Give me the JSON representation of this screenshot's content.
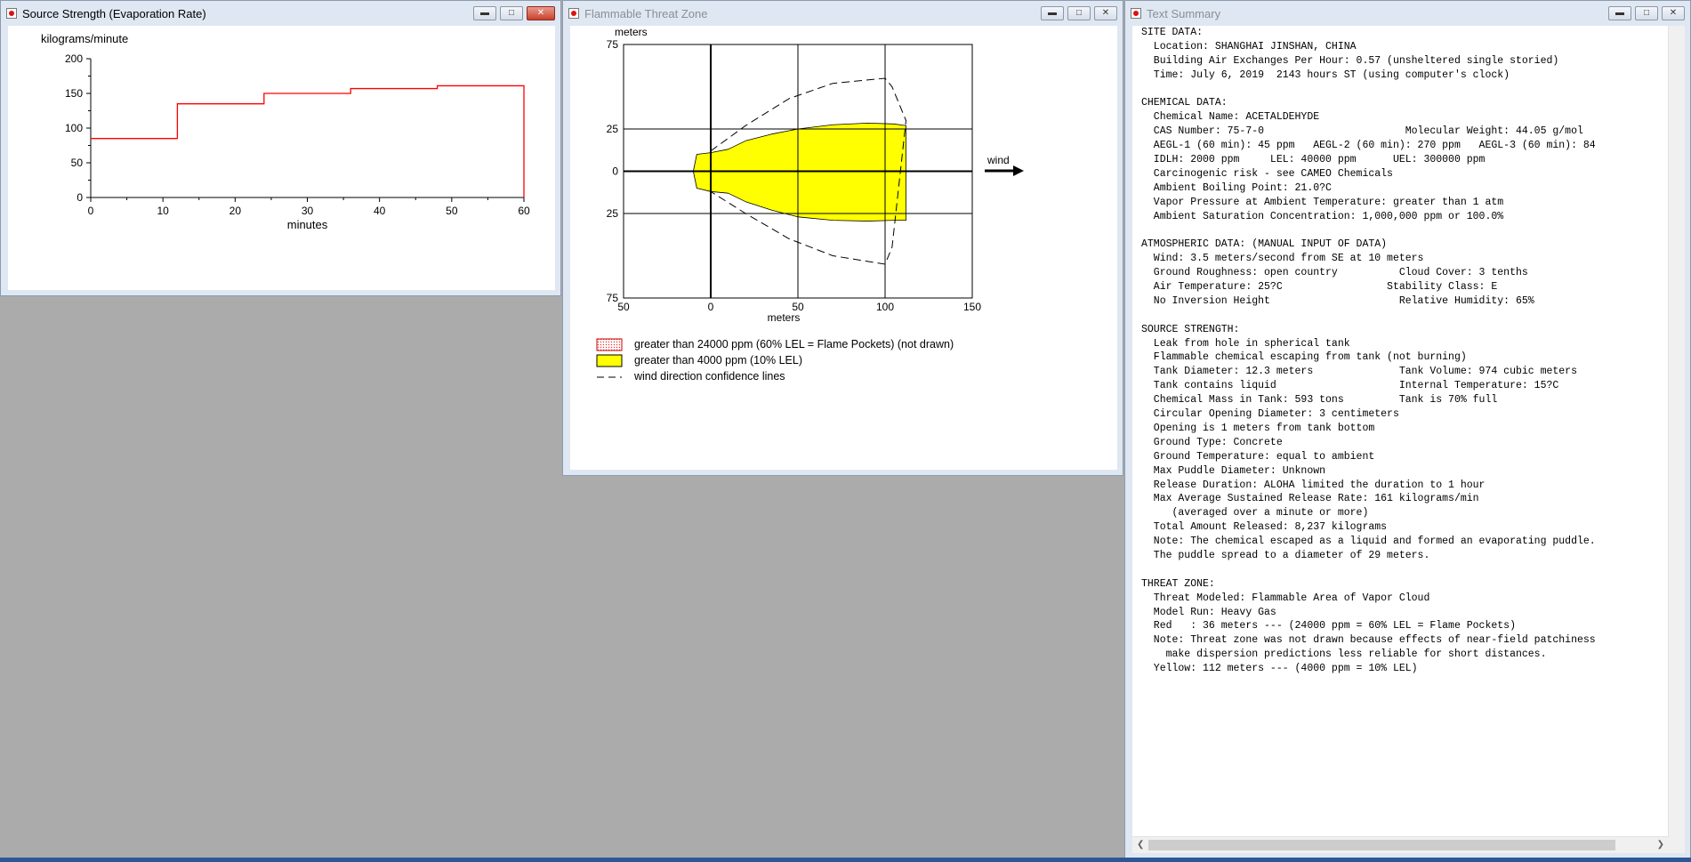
{
  "windows": {
    "source": {
      "title": "Source Strength (Evaporation Rate)"
    },
    "threat": {
      "title": "Flammable Threat Zone"
    },
    "summary": {
      "title": "Text Summary"
    }
  },
  "chart_data": [
    {
      "type": "line",
      "ylabel": "kilograms/minute",
      "xlabel": "minutes",
      "xlim": [
        0,
        60
      ],
      "ylim": [
        0,
        200
      ],
      "x_ticks": [
        "0",
        "10",
        "20",
        "30",
        "40",
        "50",
        "60"
      ],
      "y_ticks": [
        "0",
        "50",
        "100",
        "150",
        "200"
      ],
      "series": [
        {
          "color": "#ff0000",
          "step": true,
          "x": [
            0,
            12,
            12,
            24,
            24,
            36,
            36,
            48,
            48,
            60,
            60
          ],
          "y": [
            85,
            85,
            135,
            135,
            150,
            150,
            157,
            157,
            161,
            161,
            0
          ]
        }
      ]
    },
    {
      "type": "area",
      "ylabel": "meters",
      "xlabel": "meters",
      "xlim": [
        -50,
        150
      ],
      "ylim": [
        -75,
        75
      ],
      "x_ticks": [
        "50",
        "0",
        "50",
        "100",
        "150"
      ],
      "y_ticks": [
        "75",
        "25",
        "0",
        "25",
        "75"
      ],
      "wind_label": "wind",
      "legend": [
        {
          "label": "greater than 24000 ppm (60% LEL = Flame Pockets) (not drawn)",
          "swatch": "dotted-red"
        },
        {
          "label": "greater than 4000 ppm (10% LEL)",
          "swatch": "#ffff00"
        },
        {
          "label": "wind direction confidence lines",
          "swatch": "dashed"
        }
      ],
      "yellow_zone": {
        "color": "#ffff00",
        "x": [
          -10,
          -8,
          0,
          10,
          20,
          35,
          50,
          70,
          90,
          105,
          112,
          112,
          105,
          90,
          70,
          50,
          35,
          20,
          10,
          0,
          -8
        ],
        "y": [
          0,
          10,
          11,
          13,
          18,
          22,
          25,
          27.5,
          28.5,
          28,
          27,
          -29,
          -29,
          -29.5,
          -29,
          -27,
          -23,
          -18,
          -13,
          -12,
          -10
        ]
      },
      "confidence_lines": {
        "x": [
          0,
          20,
          45,
          70,
          100,
          104,
          112,
          104,
          100,
          70,
          45,
          20,
          0
        ],
        "y": [
          12,
          27,
          43,
          52,
          55,
          50,
          30,
          -45,
          -55,
          -50,
          -40,
          -25,
          -12
        ]
      }
    }
  ],
  "summary_lines": [
    "SITE DATA:",
    "  Location: SHANGHAI JINSHAN, CHINA",
    "  Building Air Exchanges Per Hour: 0.57 (unsheltered single storied)",
    "  Time: July 6, 2019  2143 hours ST (using computer's clock)",
    "",
    "CHEMICAL DATA:",
    "  Chemical Name: ACETALDEHYDE",
    "  CAS Number: 75-7-0                       Molecular Weight: 44.05 g/mol",
    "  AEGL-1 (60 min): 45 ppm   AEGL-2 (60 min): 270 ppm   AEGL-3 (60 min): 84",
    "  IDLH: 2000 ppm     LEL: 40000 ppm      UEL: 300000 ppm",
    "  Carcinogenic risk - see CAMEO Chemicals",
    "  Ambient Boiling Point: 21.0?C",
    "  Vapor Pressure at Ambient Temperature: greater than 1 atm",
    "  Ambient Saturation Concentration: 1,000,000 ppm or 100.0%",
    "",
    "ATMOSPHERIC DATA: (MANUAL INPUT OF DATA)",
    "  Wind: 3.5 meters/second from SE at 10 meters",
    "  Ground Roughness: open country          Cloud Cover: 3 tenths",
    "  Air Temperature: 25?C                 Stability Class: E",
    "  No Inversion Height                     Relative Humidity: 65%",
    "",
    "SOURCE STRENGTH:",
    "  Leak from hole in spherical tank",
    "  Flammable chemical escaping from tank (not burning)",
    "  Tank Diameter: 12.3 meters              Tank Volume: 974 cubic meters",
    "  Tank contains liquid                    Internal Temperature: 15?C",
    "  Chemical Mass in Tank: 593 tons         Tank is 70% full",
    "  Circular Opening Diameter: 3 centimeters",
    "  Opening is 1 meters from tank bottom",
    "  Ground Type: Concrete",
    "  Ground Temperature: equal to ambient",
    "  Max Puddle Diameter: Unknown",
    "  Release Duration: ALOHA limited the duration to 1 hour",
    "  Max Average Sustained Release Rate: 161 kilograms/min",
    "     (averaged over a minute or more)",
    "  Total Amount Released: 8,237 kilograms",
    "  Note: The chemical escaped as a liquid and formed an evaporating puddle.",
    "  The puddle spread to a diameter of 29 meters.",
    "",
    "THREAT ZONE:",
    "  Threat Modeled: Flammable Area of Vapor Cloud",
    "  Model Run: Heavy Gas",
    "  Red   : 36 meters --- (24000 ppm = 60% LEL = Flame Pockets)",
    "  Note: Threat zone was not drawn because effects of near-field patchiness",
    "    make dispersion predictions less reliable for short distances.",
    "  Yellow: 112 meters --- (4000 ppm = 10% LEL)"
  ],
  "icons": {
    "minimize": "minimize-icon",
    "maximize": "restore-icon",
    "close": "close-icon"
  }
}
